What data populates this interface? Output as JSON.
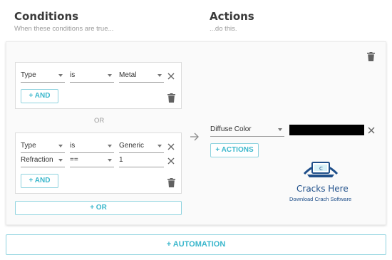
{
  "conditions": {
    "title": "Conditions",
    "subtitle": "When these conditions are true...",
    "groups": [
      {
        "rows": [
          {
            "field": "Type",
            "operator": "is",
            "value": "Metal"
          }
        ],
        "add_label": "+ AND"
      },
      {
        "rows": [
          {
            "field": "Type",
            "operator": "is",
            "value": "Generic"
          },
          {
            "field": "Refraction",
            "operator": "==",
            "value": "1"
          }
        ],
        "add_label": "+ AND"
      }
    ],
    "or_separator": "OR",
    "add_or_label": "+ OR"
  },
  "actions": {
    "title": "Actions",
    "subtitle": "...do this.",
    "rows": [
      {
        "field": "Diffuse Color",
        "color_value": "#000000"
      }
    ],
    "add_label": "+ ACTIONS"
  },
  "watermark": {
    "title": "Cracks Here",
    "subtitle": "Download Crach Software"
  },
  "add_automation_label": "+ AUTOMATION",
  "colors": {
    "accent": "#3bb7cc",
    "accent_border": "#8fd3df",
    "logo": "#1f4f8a"
  }
}
